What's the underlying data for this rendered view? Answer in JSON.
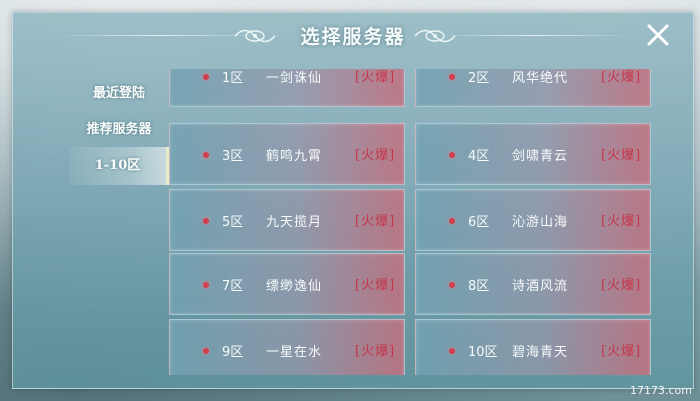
{
  "header": {
    "title": "选择服务器"
  },
  "sidebar": {
    "items": [
      {
        "label": "最近登陆"
      },
      {
        "label": "推荐服务器"
      },
      {
        "label": "1-10区",
        "active": true
      }
    ]
  },
  "servers": [
    {
      "zone": "1区",
      "name": "一剑诛仙",
      "status": "[火爆]"
    },
    {
      "zone": "2区",
      "name": "风华绝代",
      "status": "[火爆]"
    },
    {
      "zone": "3区",
      "name": "鹤鸣九霄",
      "status": "[火爆]"
    },
    {
      "zone": "4区",
      "name": "剑啸青云",
      "status": "[火爆]"
    },
    {
      "zone": "5区",
      "name": "九天揽月",
      "status": "[火爆]"
    },
    {
      "zone": "6区",
      "name": "沁游山海",
      "status": "[火爆]"
    },
    {
      "zone": "7区",
      "name": "缥缈逸仙",
      "status": "[火爆]"
    },
    {
      "zone": "8区",
      "name": "诗酒风流",
      "status": "[火爆]"
    },
    {
      "zone": "9区",
      "name": "一星在水",
      "status": "[火爆]"
    },
    {
      "zone": "10区",
      "name": "碧海青天",
      "status": "[火爆]"
    }
  ],
  "colors": {
    "hot_status": "#c4364a",
    "status_dot": "#d23f4f"
  },
  "watermark": "17173.com"
}
